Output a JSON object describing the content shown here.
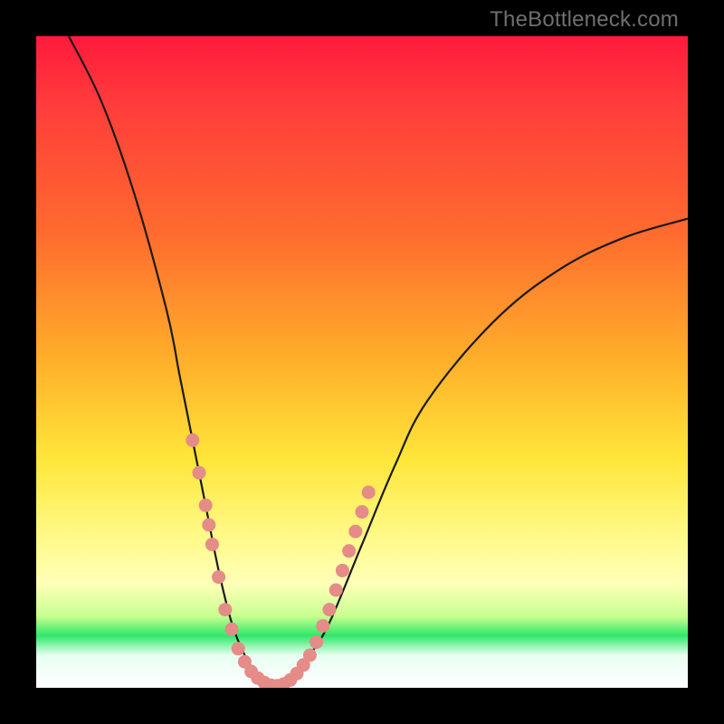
{
  "watermark": "TheBottleneck.com",
  "colors": {
    "curve_stroke": "#1a1a1a",
    "marker_fill": "#e58b88",
    "frame_bg": "#000000"
  },
  "chart_data": {
    "type": "line",
    "title": "",
    "xlabel": "",
    "ylabel": "",
    "xlim": [
      0,
      100
    ],
    "ylim": [
      0,
      100
    ],
    "grid": false,
    "series": [
      {
        "name": "bottleneck-curve",
        "x": [
          5,
          10,
          15,
          20,
          22,
          24,
          26,
          28,
          30,
          32,
          34,
          36,
          38,
          40,
          42,
          45,
          50,
          55,
          60,
          70,
          80,
          90,
          100
        ],
        "y": [
          100,
          90,
          76,
          58,
          48,
          38,
          28,
          18,
          10,
          5,
          2,
          0,
          0,
          2,
          5,
          10,
          22,
          34,
          44,
          56,
          64,
          69,
          72
        ]
      }
    ],
    "markers": [
      {
        "name": "left-cluster",
        "x": 24,
        "y": 38
      },
      {
        "name": "left-cluster",
        "x": 25,
        "y": 33
      },
      {
        "name": "left-cluster",
        "x": 26,
        "y": 28
      },
      {
        "name": "left-cluster",
        "x": 26.5,
        "y": 25
      },
      {
        "name": "left-cluster",
        "x": 27,
        "y": 22
      },
      {
        "name": "left-cluster",
        "x": 28,
        "y": 17
      },
      {
        "name": "left-cluster",
        "x": 29,
        "y": 12
      },
      {
        "name": "left-cluster",
        "x": 30,
        "y": 9
      },
      {
        "name": "bottom",
        "x": 31,
        "y": 6
      },
      {
        "name": "bottom",
        "x": 32,
        "y": 4
      },
      {
        "name": "bottom",
        "x": 33,
        "y": 2.5
      },
      {
        "name": "bottom",
        "x": 34,
        "y": 1.5
      },
      {
        "name": "bottom",
        "x": 35,
        "y": 0.8
      },
      {
        "name": "bottom",
        "x": 36,
        "y": 0.4
      },
      {
        "name": "bottom",
        "x": 37,
        "y": 0.3
      },
      {
        "name": "bottom",
        "x": 38,
        "y": 0.6
      },
      {
        "name": "bottom",
        "x": 39,
        "y": 1.2
      },
      {
        "name": "bottom",
        "x": 40,
        "y": 2.2
      },
      {
        "name": "bottom",
        "x": 41,
        "y": 3.5
      },
      {
        "name": "bottom",
        "x": 42,
        "y": 5
      },
      {
        "name": "right-cluster",
        "x": 43,
        "y": 7
      },
      {
        "name": "right-cluster",
        "x": 44,
        "y": 9.5
      },
      {
        "name": "right-cluster",
        "x": 45,
        "y": 12
      },
      {
        "name": "right-cluster",
        "x": 46,
        "y": 15
      },
      {
        "name": "right-cluster",
        "x": 47,
        "y": 18
      },
      {
        "name": "right-cluster",
        "x": 48,
        "y": 21
      },
      {
        "name": "right-cluster",
        "x": 49,
        "y": 24
      },
      {
        "name": "right-cluster",
        "x": 50,
        "y": 27
      },
      {
        "name": "right-cluster",
        "x": 51,
        "y": 30
      }
    ]
  }
}
